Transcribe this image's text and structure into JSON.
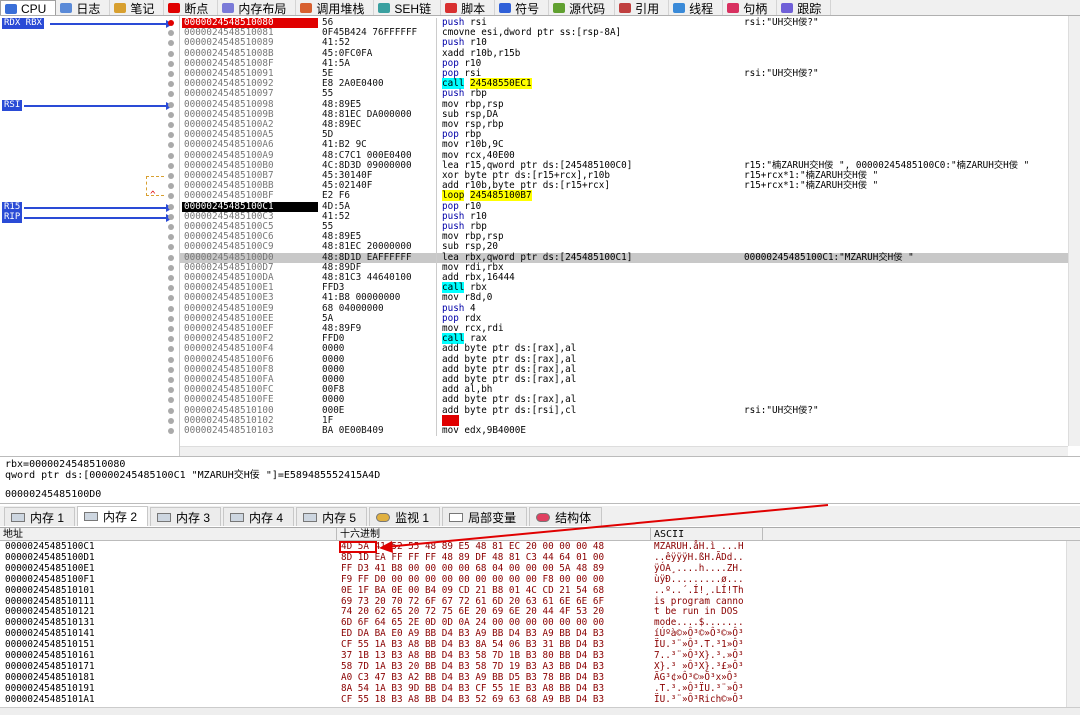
{
  "top_tabs": [
    {
      "label": "CPU",
      "icon": "cpu-icon",
      "active": true
    },
    {
      "label": "日志",
      "icon": "log-icon"
    },
    {
      "label": "笔记",
      "icon": "notes-icon"
    },
    {
      "label": "断点",
      "icon": "breakpoint-icon"
    },
    {
      "label": "内存布局",
      "icon": "memory-map-icon"
    },
    {
      "label": "调用堆栈",
      "icon": "call-stack-icon"
    },
    {
      "label": "SEH链",
      "icon": "seh-icon"
    },
    {
      "label": "脚本",
      "icon": "script-icon"
    },
    {
      "label": "符号",
      "icon": "symbols-icon"
    },
    {
      "label": "源代码",
      "icon": "source-icon"
    },
    {
      "label": "引用",
      "icon": "references-icon"
    },
    {
      "label": "线程",
      "icon": "threads-icon"
    },
    {
      "label": "句柄",
      "icon": "handles-icon"
    },
    {
      "label": "跟踪",
      "icon": "trace-icon"
    }
  ],
  "registers": [
    {
      "label": "RDX RBX",
      "row": 0
    },
    {
      "label": "RSI",
      "row": 8
    },
    {
      "label": "R15",
      "row": 18
    },
    {
      "label": "RIP",
      "row": 19
    }
  ],
  "disasm": [
    {
      "addr": "0000024548510080",
      "bytes": "56",
      "mn": "push",
      "op": "rsi",
      "cmt": "rsi:\"UH交H佞?\"",
      "addr_style": "bp",
      "dot": "red",
      "kind": "push"
    },
    {
      "addr": "0000024548510081",
      "bytes": "0F45B424 76FFFFFF",
      "mn": "cmovne",
      "op": "esi,dword ptr ss:[rsp-8A]",
      "cmt": ""
    },
    {
      "addr": "0000024548510089",
      "bytes": "41:52",
      "mn": "push",
      "op": "r10",
      "cmt": "",
      "kind": "push"
    },
    {
      "addr": "000002454851008B",
      "bytes": "45:0FC0FA",
      "mn": "xadd",
      "op": "r10b,r15b",
      "cmt": ""
    },
    {
      "addr": "000002454851008F",
      "bytes": "41:5A",
      "mn": "pop",
      "op": "r10",
      "cmt": "",
      "kind": "push"
    },
    {
      "addr": "0000024548510091",
      "bytes": "5E",
      "mn": "pop",
      "op": "rsi",
      "cmt": "rsi:\"UH交H佞?\"",
      "kind": "push"
    },
    {
      "addr": "0000024548510092",
      "bytes": "E8 2A0E0400",
      "mn": "call",
      "op": "24548550EC1",
      "cmt": "",
      "kind": "call",
      "opkind": "jump"
    },
    {
      "addr": "0000024548510097",
      "bytes": "55",
      "mn": "push",
      "op": "rbp",
      "cmt": "",
      "kind": "push"
    },
    {
      "addr": "0000024548510098",
      "bytes": "48:89E5",
      "mn": "mov",
      "op": "rbp,rsp",
      "cmt": ""
    },
    {
      "addr": "000002454851009B",
      "bytes": "48:81EC DA000000",
      "mn": "sub",
      "op": "rsp,DA",
      "cmt": ""
    },
    {
      "addr": "00000245485100A2",
      "bytes": "48:89EC",
      "mn": "mov",
      "op": "rsp,rbp",
      "cmt": ""
    },
    {
      "addr": "00000245485100A5",
      "bytes": "5D",
      "mn": "pop",
      "op": "rbp",
      "cmt": "",
      "kind": "push"
    },
    {
      "addr": "00000245485100A6",
      "bytes": "41:B2 9C",
      "mn": "mov",
      "op": "r10b,9C",
      "cmt": ""
    },
    {
      "addr": "00000245485100A9",
      "bytes": "48:C7C1 000E0400",
      "mn": "mov",
      "op": "rcx,40E00",
      "cmt": ""
    },
    {
      "addr": "00000245485100B0",
      "bytes": "4C:8D3D 09000000",
      "mn": "lea",
      "op": "r15,qword ptr ds:[245485100C0]",
      "cmt": "r15:\"楠ZARUH交H佞 \", 00000245485100C0:\"楠ZARUH交H佞 \""
    },
    {
      "addr": "00000245485100B7",
      "bytes": "45:30140F",
      "mn": "xor",
      "op": "byte ptr ds:[r15+rcx],r10b",
      "cmt": "r15+rcx*1:\"楠ZARUH交H佞 \""
    },
    {
      "addr": "00000245485100BB",
      "bytes": "45:02140F",
      "mn": "add",
      "op": "r10b,byte ptr ds:[r15+rcx]",
      "cmt": "r15+rcx*1:\"楠ZARUH交H佞 \""
    },
    {
      "addr": "00000245485100BF",
      "bytes": "E2 F6",
      "mn": "loop",
      "op": "245485100B7",
      "cmt": "",
      "kind": "jump",
      "mark": "^"
    },
    {
      "addr": "00000245485100C1",
      "bytes": "4D:5A",
      "mn": "pop",
      "op": "r10",
      "cmt": "",
      "kind": "push",
      "addr_style": "cur"
    },
    {
      "addr": "00000245485100C3",
      "bytes": "41:52",
      "mn": "push",
      "op": "r10",
      "cmt": "",
      "kind": "push"
    },
    {
      "addr": "00000245485100C5",
      "bytes": "55",
      "mn": "push",
      "op": "rbp",
      "cmt": "",
      "kind": "push"
    },
    {
      "addr": "00000245485100C6",
      "bytes": "48:89E5",
      "mn": "mov",
      "op": "rbp,rsp",
      "cmt": ""
    },
    {
      "addr": "00000245485100C9",
      "bytes": "48:81EC 20000000",
      "mn": "sub",
      "op": "rsp,20",
      "cmt": ""
    },
    {
      "addr": "00000245485100D0",
      "bytes": "48:8D1D EAFFFFFF",
      "mn": "lea",
      "op": "rbx,qword ptr ds:[245485100C1]",
      "cmt": "00000245485100C1:\"MZARUH交H佞 \"",
      "hl": true
    },
    {
      "addr": "00000245485100D7",
      "bytes": "48:89DF",
      "mn": "mov",
      "op": "rdi,rbx",
      "cmt": ""
    },
    {
      "addr": "00000245485100DA",
      "bytes": "48:81C3 44640100",
      "mn": "add",
      "op": "rbx,16444",
      "cmt": ""
    },
    {
      "addr": "00000245485100E1",
      "bytes": "FFD3",
      "mn": "call",
      "op": "rbx",
      "cmt": "",
      "kind": "call"
    },
    {
      "addr": "00000245485100E3",
      "bytes": "41:B8 00000000",
      "mn": "mov",
      "op": "r8d,0",
      "cmt": ""
    },
    {
      "addr": "00000245485100E9",
      "bytes": "68 04000000",
      "mn": "push",
      "op": "4",
      "cmt": "",
      "kind": "push"
    },
    {
      "addr": "00000245485100EE",
      "bytes": "5A",
      "mn": "pop",
      "op": "rdx",
      "cmt": "",
      "kind": "push"
    },
    {
      "addr": "00000245485100EF",
      "bytes": "48:89F9",
      "mn": "mov",
      "op": "rcx,rdi",
      "cmt": ""
    },
    {
      "addr": "00000245485100F2",
      "bytes": "FFD0",
      "mn": "call",
      "op": "rax",
      "cmt": "",
      "kind": "call"
    },
    {
      "addr": "00000245485100F4",
      "bytes": "0000",
      "mn": "add",
      "op": "byte ptr ds:[rax],al",
      "cmt": ""
    },
    {
      "addr": "00000245485100F6",
      "bytes": "0000",
      "mn": "add",
      "op": "byte ptr ds:[rax],al",
      "cmt": ""
    },
    {
      "addr": "00000245485100F8",
      "bytes": "0000",
      "mn": "add",
      "op": "byte ptr ds:[rax],al",
      "cmt": ""
    },
    {
      "addr": "00000245485100FA",
      "bytes": "0000",
      "mn": "add",
      "op": "byte ptr ds:[rax],al",
      "cmt": ""
    },
    {
      "addr": "00000245485100FC",
      "bytes": "00F8",
      "mn": "add",
      "op": "al,bh",
      "cmt": ""
    },
    {
      "addr": "00000245485100FE",
      "bytes": "0000",
      "mn": "add",
      "op": "byte ptr ds:[rax],al",
      "cmt": ""
    },
    {
      "addr": "0000024548510100",
      "bytes": "000E",
      "mn": "add",
      "op": "byte ptr ds:[rsi],cl",
      "cmt": "rsi:\"UH交H佞?\""
    },
    {
      "addr": "0000024548510102",
      "bytes": "1F",
      "mn": "???",
      "op": "",
      "cmt": "",
      "kind": "int"
    },
    {
      "addr": "0000024548510103",
      "bytes": "BA 0E00B409",
      "mn": "mov",
      "op": "edx,9B4000E",
      "cmt": ""
    }
  ],
  "info": {
    "line1": "rbx=0000024548510080",
    "line2": "qword ptr ds:[00000245485100C1 \"MZARUH交H佞 \"]=E589485552415A4D",
    "line3": "00000245485100D0"
  },
  "mem_tabs": [
    {
      "label": "内存 1",
      "icon": "memory-icon"
    },
    {
      "label": "内存 2",
      "icon": "memory-icon",
      "active": true
    },
    {
      "label": "内存 3",
      "icon": "memory-icon"
    },
    {
      "label": "内存 4",
      "icon": "memory-icon"
    },
    {
      "label": "内存 5",
      "icon": "memory-icon"
    },
    {
      "label": "监视 1",
      "icon": "watch-icon"
    },
    {
      "label": "局部变量",
      "icon": "locals-icon"
    },
    {
      "label": "结构体",
      "icon": "struct-icon"
    }
  ],
  "dump_headers": {
    "addr": "地址",
    "hex": "十六进制",
    "ascii": "ASCII"
  },
  "dump": [
    {
      "addr": "00000245485100C1",
      "hex": "4D 5A 41 52 55 48 89 E5 48 81 EC 20 00 00 00 48",
      "ascii": "MZARUH.åH.ì ...H"
    },
    {
      "addr": "00000245485100D1",
      "hex": "8D 1D EA FF FF FF 48 89 DF 48 81 C3 44 64 01 00",
      "ascii": "..êÿÿÿH.ßH.ÃDd.."
    },
    {
      "addr": "00000245485100E1",
      "hex": "FF D3 41 B8 00 00 00 00 68 04 00 00 00 5A 48 89",
      "ascii": "ÿÓA¸....h....ZH."
    },
    {
      "addr": "00000245485100F1",
      "hex": "F9 FF D0 00 00 00 00 00 00 00 00 00 F8 00 00 00",
      "ascii": "ùÿÐ.........ø..."
    },
    {
      "addr": "0000024548510101",
      "hex": "0E 1F BA 0E 00 B4 09 CD 21 B8 01 4C CD 21 54 68",
      "ascii": "..º..´.Í!¸.LÍ!Th"
    },
    {
      "addr": "0000024548510111",
      "hex": "69 73 20 70 72 6F 67 72 61 6D 20 63 61 6E 6E 6F",
      "ascii": "is program canno"
    },
    {
      "addr": "0000024548510121",
      "hex": "74 20 62 65 20 72 75 6E 20 69 6E 20 44 4F 53 20",
      "ascii": "t be run in DOS "
    },
    {
      "addr": "0000024548510131",
      "hex": "6D 6F 64 65 2E 0D 0D 0A 24 00 00 00 00 00 00 00",
      "ascii": "mode....$......."
    },
    {
      "addr": "0000024548510141",
      "hex": "ED DA BA E0 A9 BB D4 B3 A9 BB D4 B3 A9 BB D4 B3",
      "ascii": "íÚºà©»Ô³©»Ô³©»Ô³"
    },
    {
      "addr": "0000024548510151",
      "hex": "CF 55 1A B3 A8 BB D4 B3 8A 54 06 B3 31 BB D4 B3",
      "ascii": "ÏU.³¨»Ô³.T.³1»Ô³"
    },
    {
      "addr": "0000024548510161",
      "hex": "37 1B 13 B3 A8 BB D4 B3 58 7D 1B B3 80 BB D4 B3",
      "ascii": "7..³¨»Ô³X}.³.»Ô³"
    },
    {
      "addr": "0000024548510171",
      "hex": "58 7D 1A B3 20 BB D4 B3 58 7D 19 B3 A3 BB D4 B3",
      "ascii": "X}.³ »Ô³X}.³£»Ô³"
    },
    {
      "addr": "0000024548510181",
      "hex": "A0 C3 47 B3 A2 BB D4 B3 A9 BB D5 B3 78 BB D4 B3",
      "ascii": " ÃG³¢»Ô³©»Õ³x»Ô³"
    },
    {
      "addr": "0000024548510191",
      "hex": "8A 54 1A B3 9D BB D4 B3 CF 55 1E B3 A8 BB D4 B3",
      "ascii": ".T.³.»Ô³ÏU.³¨»Ô³"
    },
    {
      "addr": "00000245485101A1",
      "hex": "CF 55 18 B3 A8 BB D4 B3 52 69 63 68 A9 BB D4 B3",
      "ascii": "ÏU.³¨»Ô³Rich©»Ô³"
    }
  ]
}
